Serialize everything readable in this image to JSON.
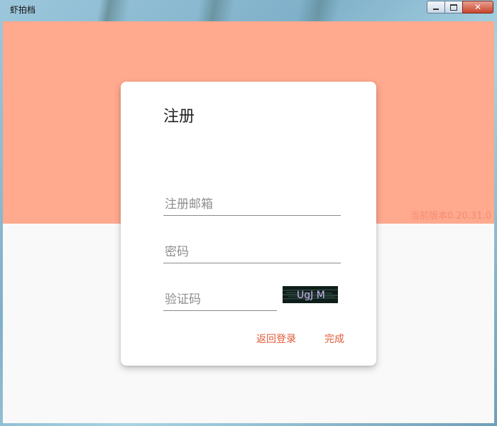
{
  "window": {
    "title": "虾拍档",
    "controls": {
      "minimize_icon": "minimize-icon",
      "maximize_icon": "maximize-icon",
      "close_icon": "close-icon"
    }
  },
  "version_text": "当前版本0.20.31.0",
  "form": {
    "title": "注册",
    "email": {
      "placeholder": "注册邮箱",
      "value": ""
    },
    "password": {
      "placeholder": "密码",
      "value": ""
    },
    "captcha_input": {
      "placeholder": "验证码",
      "value": ""
    },
    "captcha_image_text": "UgJ M",
    "back_to_login_label": "返回登录",
    "done_label": "完成"
  },
  "colors": {
    "accent": "#e05a38",
    "header_band": "#ffa98f",
    "version_text": "#f58d71",
    "background": "#f9f9f9"
  }
}
